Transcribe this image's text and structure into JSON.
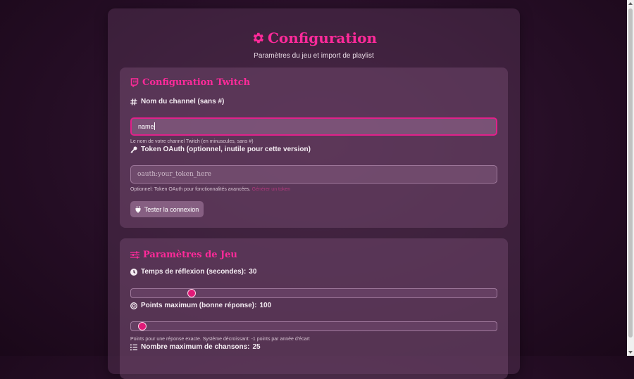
{
  "page": {
    "title": "Configuration",
    "subtitle": "Paramètres du jeu et import de playlist"
  },
  "twitch": {
    "title": "Configuration Twitch",
    "channel": {
      "label": "Nom du channel (sans #)",
      "value": "name",
      "help": "Le nom de votre channel Twitch (en minuscules, sans #)"
    },
    "token": {
      "label": "Token OAuth (optionnel, inutile pour cette version)",
      "placeholder": "oauth:your_token_here",
      "help": "Optionnel: Token OAuth pour fonctionnalités avancées.",
      "help_link": "Générer un token"
    },
    "test_button": "Tester la connexion"
  },
  "game": {
    "title": "Paramètres de Jeu",
    "thinking_time": {
      "label": "Temps de réflexion (secondes):",
      "value": "30",
      "fraction": 0.165
    },
    "max_points": {
      "label": "Points maximum (bonne réponse):",
      "value": "100",
      "fraction": 0.03,
      "help": "Points pour une réponse exacte. Système décroissant: -1 points par année d'écart"
    },
    "max_songs": {
      "label": "Nombre maximum de chansons:",
      "value": "25"
    }
  },
  "colors": {
    "accent": "#ff2a9a",
    "slider_thumb": "#e01a78"
  },
  "icons": [
    "gear-icon",
    "twitch-icon",
    "hashtag-icon",
    "key-icon",
    "plug-icon",
    "sliders-icon",
    "clock-icon",
    "target-icon",
    "list-icon"
  ]
}
